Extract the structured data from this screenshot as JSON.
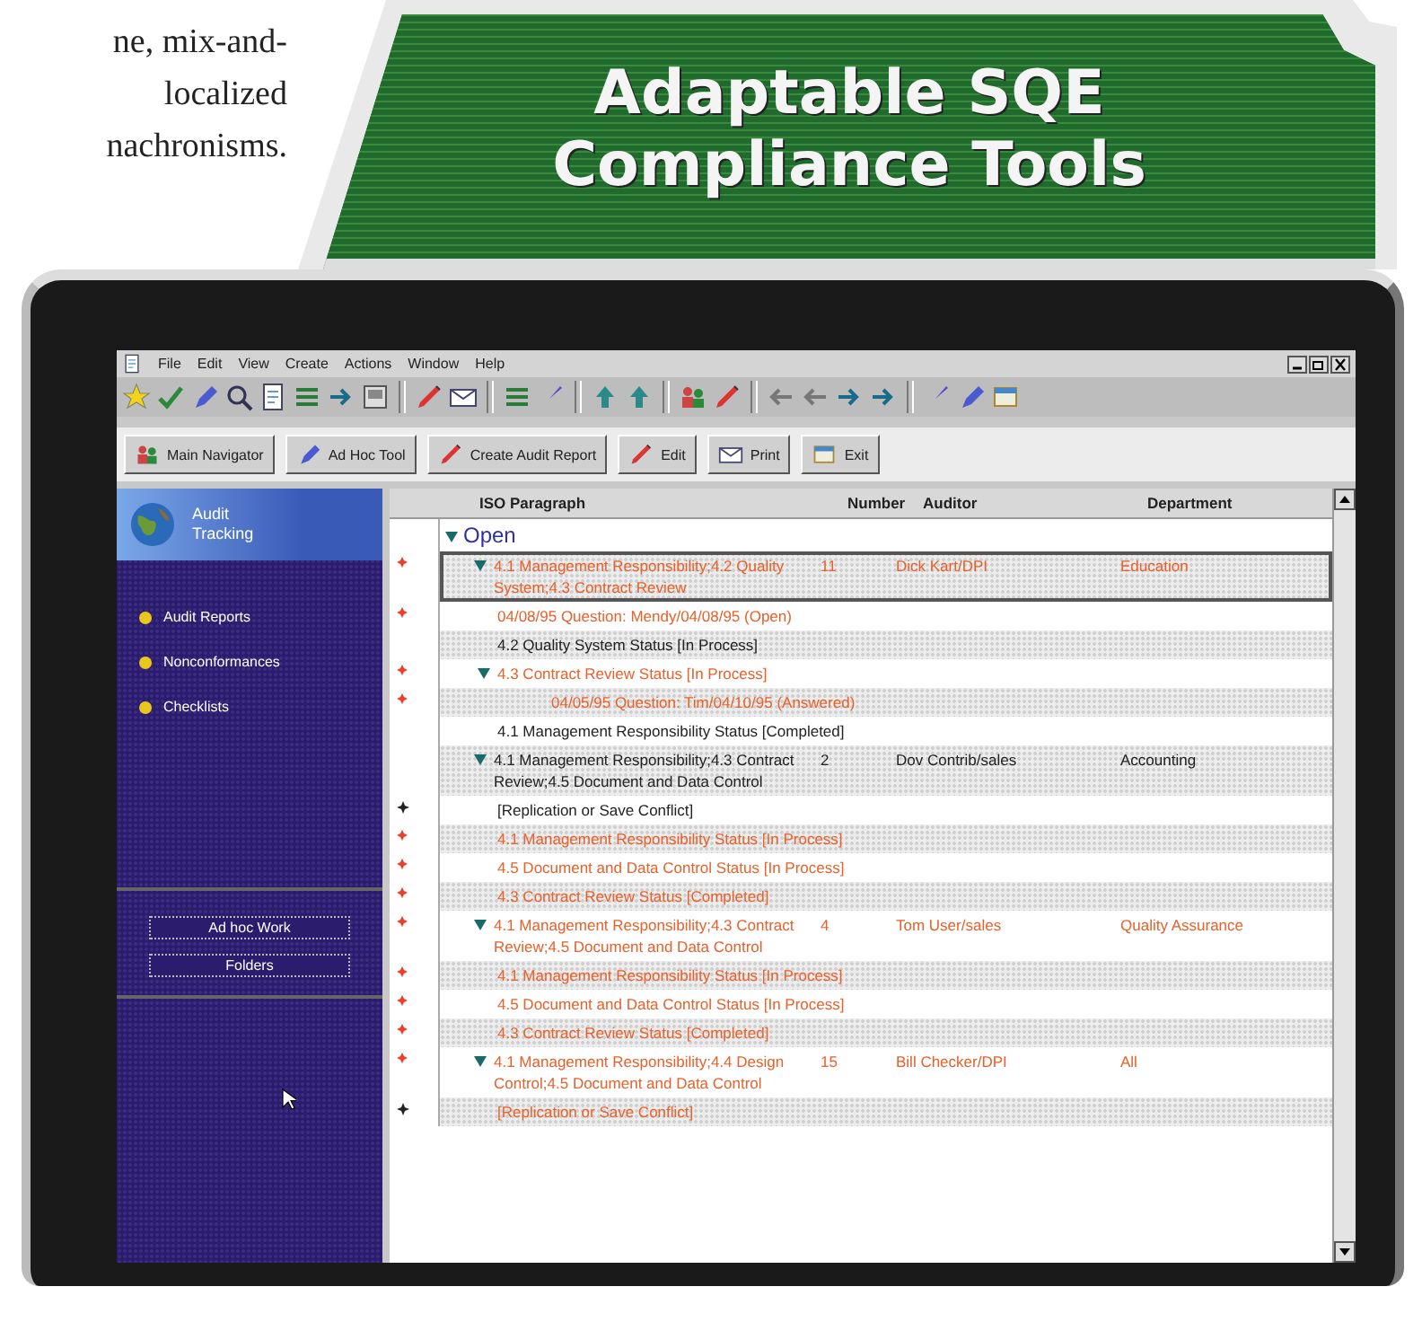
{
  "article_text": [
    "ne, mix-and-",
    "localized",
    "nachronisms."
  ],
  "banner": {
    "title_lines": [
      "Adaptable SQE",
      "Compliance Tools"
    ]
  },
  "window": {
    "menu": [
      "File",
      "Edit",
      "View",
      "Create",
      "Actions",
      "Window",
      "Help"
    ]
  },
  "action_bar": [
    {
      "label": "Main Navigator"
    },
    {
      "label": "Ad Hoc Tool"
    },
    {
      "label": "Create Audit Report"
    },
    {
      "label": "Edit"
    },
    {
      "label": "Print"
    },
    {
      "label": "Exit"
    }
  ],
  "sidebar": {
    "title": "Audit Tracking",
    "items": [
      {
        "label": "Audit Reports",
        "selected": false
      },
      {
        "label": "Nonconformances",
        "selected": false
      },
      {
        "label": "Checklists",
        "selected": false
      }
    ],
    "buttons": [
      "Ad hoc Work",
      "Folders"
    ]
  },
  "table": {
    "columns": [
      "ISO Paragraph",
      "Number",
      "Auditor",
      "Department"
    ],
    "rows": [
      {
        "kind": "category",
        "label": "Open",
        "expanded": true,
        "selected": false,
        "children": [
          {
            "kind": "document",
            "title": "4.1  Management Responsibility;4.2  Quality System;4.3  Contract Review",
            "number": "11",
            "auditor": "Dick Kart/DPI",
            "department": "Education",
            "flagged": true,
            "conflict": false,
            "unread": true,
            "expanded": true,
            "selected": true,
            "children": [
              {
                "kind": "response",
                "text": "04/08/95 Question: Mendy/04/08/95 (Open)",
                "flagged": true,
                "conflict": false,
                "unread": true,
                "selected": false
              },
              {
                "kind": "response",
                "text": "4.2  Quality System  Status [In Process]",
                "flagged": false,
                "conflict": false,
                "unread": false,
                "selected": false
              },
              {
                "kind": "response",
                "text": "4.3  Contract Review  Status [In Process]",
                "flagged": true,
                "conflict": false,
                "unread": true,
                "expanded": true,
                "selected": false,
                "children": [
                  {
                    "kind": "response",
                    "text": "04/05/95 Question: Tim/04/10/95 (Answered)",
                    "flagged": true,
                    "conflict": false,
                    "unread": true,
                    "selected": false
                  }
                ]
              },
              {
                "kind": "response",
                "text": "4.1  Management Responsibility  Status [Completed]",
                "flagged": false,
                "conflict": false,
                "unread": false,
                "selected": false
              }
            ]
          },
          {
            "kind": "document",
            "title": "4.1  Management Responsibility;4.3  Contract Review;4.5  Document and Data Control",
            "number": "2",
            "auditor": "Dov Contrib/sales",
            "department": "Accounting",
            "flagged": false,
            "conflict": false,
            "unread": false,
            "expanded": true,
            "selected": false,
            "children": [
              {
                "kind": "response",
                "text": "[Replication or Save Conflict]",
                "flagged": false,
                "conflict": true,
                "unread": false,
                "selected": false
              },
              {
                "kind": "response",
                "text": "4.1  Management Responsibility  Status [In Process]",
                "flagged": true,
                "conflict": false,
                "unread": true,
                "selected": false
              },
              {
                "kind": "response",
                "text": "4.5  Document and Data Control  Status [In Process]",
                "flagged": true,
                "conflict": false,
                "unread": true,
                "selected": false
              },
              {
                "kind": "response",
                "text": "4.3  Contract Review  Status [Completed]",
                "flagged": true,
                "conflict": false,
                "unread": true,
                "selected": false
              }
            ]
          },
          {
            "kind": "document",
            "title": "4.1  Management Responsibility;4.3  Contract Review;4.5  Document and Data Control",
            "number": "4",
            "auditor": "Tom User/sales",
            "department": "Quality Assurance",
            "flagged": true,
            "conflict": false,
            "unread": true,
            "expanded": true,
            "selected": false,
            "children": [
              {
                "kind": "response",
                "text": "4.1  Management Responsibility  Status [In Process]",
                "flagged": true,
                "conflict": false,
                "unread": true,
                "selected": false
              },
              {
                "kind": "response",
                "text": "4.5  Document and Data Control  Status [In Process]",
                "flagged": true,
                "conflict": false,
                "unread": true,
                "selected": false
              },
              {
                "kind": "response",
                "text": "4.3  Contract Review  Status [Completed]",
                "flagged": true,
                "conflict": false,
                "unread": true,
                "selected": false
              }
            ]
          },
          {
            "kind": "document",
            "title": "4.1  Management Responsibility;4.4  Design Control;4.5  Document and Data Control",
            "number": "15",
            "auditor": "Bill Checker/DPI",
            "department": "All",
            "flagged": true,
            "conflict": false,
            "unread": true,
            "expanded": true,
            "selected": false,
            "children": [
              {
                "kind": "response",
                "text": "[Replication or Save Conflict]",
                "flagged": false,
                "conflict": true,
                "unread": true,
                "selected": false
              }
            ]
          }
        ]
      }
    ]
  }
}
